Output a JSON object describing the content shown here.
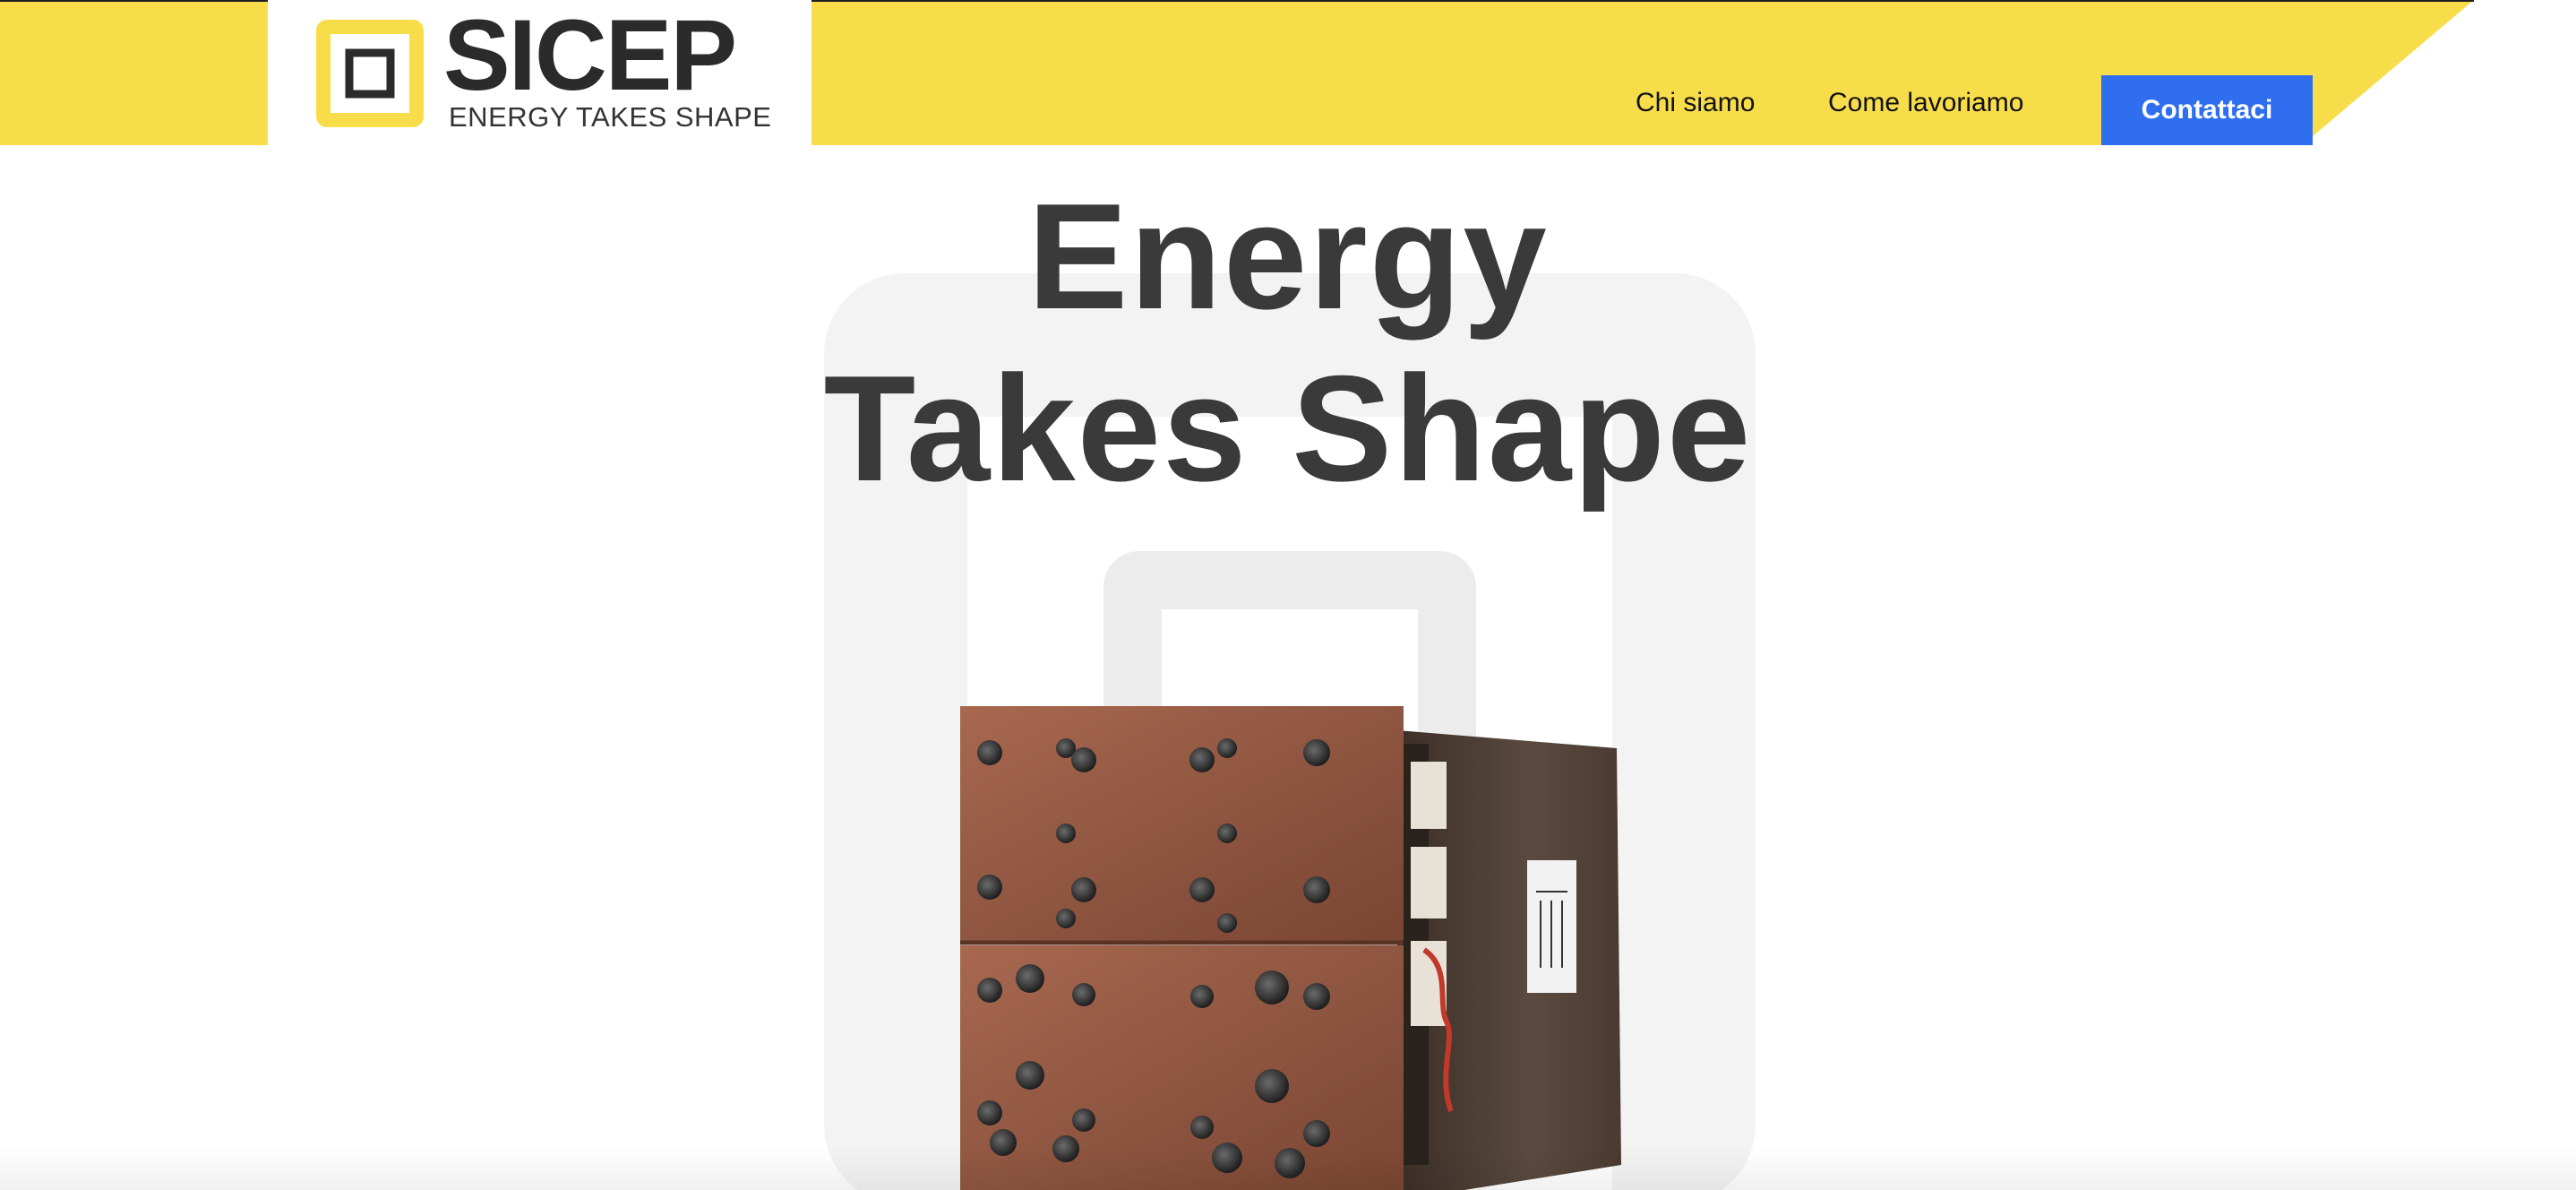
{
  "brand": {
    "name": "SICEP",
    "tagline": "ENERGY TAKES SHAPE",
    "accent_color": "#f8dd4a",
    "logo_icon": "square-logo-icon"
  },
  "nav": {
    "items": [
      {
        "label": "Chi siamo"
      },
      {
        "label": "Come lavoriamo"
      }
    ],
    "cta_label": "Contattaci",
    "cta_color": "#2f6fef"
  },
  "hero": {
    "title_line1": "Energy",
    "title_line2": "Takes Shape",
    "title_color": "#3a3a3a",
    "product_image": "battery-module-image"
  }
}
